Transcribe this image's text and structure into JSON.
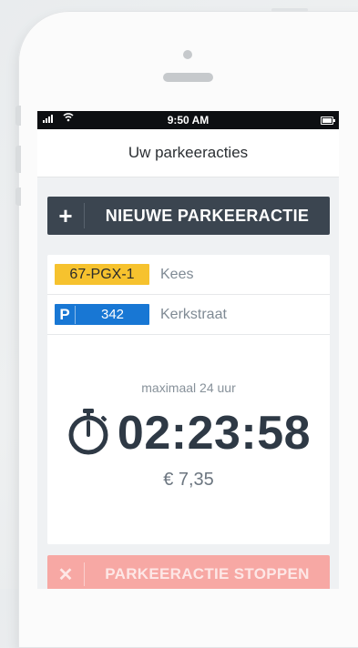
{
  "status_bar": {
    "time": "9:50 AM"
  },
  "header": {
    "title": "Uw parkeeracties"
  },
  "new_action_button": {
    "icon": "plus-icon",
    "label": "NIEUWE PARKEERACTIE"
  },
  "parking": {
    "plate": "67-PGX-1",
    "owner": "Kees",
    "zone_letter": "P",
    "zone_number": "342",
    "street": "Kerkstraat",
    "max_duration": "maximaal 24 uur",
    "timer": "02:23:58",
    "price": "€ 7,35"
  },
  "stop_button": {
    "icon": "close-icon",
    "label": "PARKEERACTIE STOPPEN"
  },
  "colors": {
    "accent_dark": "#3b4550",
    "plate_yellow": "#f6c22e",
    "zone_blue": "#1877d4",
    "stop_red": "#f7a8a4"
  }
}
